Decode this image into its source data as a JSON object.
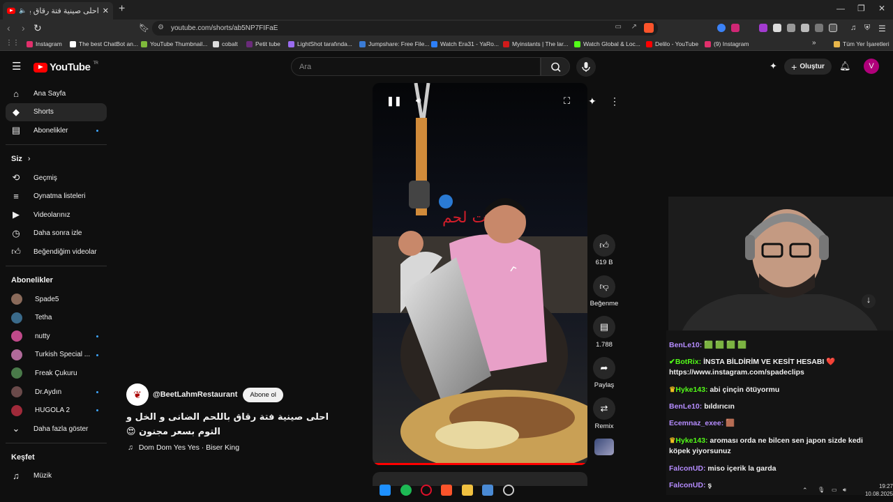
{
  "browser": {
    "tab_title": "احلی صینیة فتة رقاق باللحم الد",
    "url": "youtube.com/shorts/ab5NP7FIFaE",
    "bookmarks": [
      {
        "label": "Instagram",
        "color": "#e1306c"
      },
      {
        "label": "The best ChatBot an...",
        "color": "#ffffff"
      },
      {
        "label": "YouTube Thumbnail...",
        "color": "#7fb93b"
      },
      {
        "label": "cobalt",
        "color": "#dddddd"
      },
      {
        "label": "Petit tube",
        "color": "#6a2b7a"
      },
      {
        "label": "LightShot tarafında...",
        "color": "#9b6cf0"
      },
      {
        "label": "Jumpshare: Free File...",
        "color": "#3a7bd5"
      },
      {
        "label": "Watch Era31 - YaRo...",
        "color": "#2d7ff9"
      },
      {
        "label": "Myinstants | The lar...",
        "color": "#d11a1a"
      },
      {
        "label": "Watch Global & Loc...",
        "color": "#53fc18"
      },
      {
        "label": "Delilo - YouTube",
        "color": "#ff0000"
      },
      {
        "label": "(9) Instagram",
        "color": "#e1306c"
      }
    ],
    "all_bookmarks": "Tüm Yer İşaretleri"
  },
  "masthead": {
    "logo": "YouTube",
    "logo_country": "TR",
    "search_placeholder": "Ara",
    "create_label": "Oluştur",
    "avatar_letter": "V"
  },
  "sidebar": {
    "main": [
      {
        "label": "Ana Sayfa",
        "icon": "home-icon"
      },
      {
        "label": "Shorts",
        "icon": "shorts-icon"
      },
      {
        "label": "Abonelikler",
        "icon": "subscriptions-icon"
      }
    ],
    "you_heading": "Siz",
    "you": [
      {
        "label": "Geçmiş",
        "icon": "history-icon"
      },
      {
        "label": "Oynatma listeleri",
        "icon": "playlists-icon"
      },
      {
        "label": "Videolarınız",
        "icon": "your-videos-icon"
      },
      {
        "label": "Daha sonra izle",
        "icon": "watch-later-icon"
      },
      {
        "label": "Beğendiğim videolar",
        "icon": "liked-icon"
      }
    ],
    "subs_heading": "Abonelikler",
    "subs": [
      {
        "label": "Spade5",
        "color": "#8a6a5a"
      },
      {
        "label": "Tetha",
        "color": "#3a6a8a"
      },
      {
        "label": "nutty",
        "color": "#c04a8a"
      },
      {
        "label": "Turkish Special ...",
        "color": "#b06a9a"
      },
      {
        "label": "Freak Çukuru",
        "color": "#4a7a4a"
      },
      {
        "label": "Dr.Aydın",
        "color": "#6a4a4a"
      },
      {
        "label": "HUGOLA 2",
        "color": "#a02a3a"
      }
    ],
    "show_more": "Daha fazla göster",
    "explore_heading": "Keşfet",
    "explore": [
      {
        "label": "Müzik",
        "icon": "music-icon"
      }
    ]
  },
  "short": {
    "channel": "@BeetLahmRestaurant",
    "subscribe_label": "Abone ol",
    "title": "احلی صینیة فتة رقاق باللحم الضانی و الخل و التوم بسعر مجنون 😍",
    "music": "Dom Dom Yes Yes · Biser King",
    "progress": 0.99
  },
  "actions": {
    "likes": "619 B",
    "dislike": "Beğenme",
    "comments": "1.788",
    "share": "Paylaş",
    "remix": "Remix"
  },
  "chat": [
    {
      "user": "BenLe10:",
      "color": "#b58cff",
      "text": "🟩 🟩 🟩 🟩"
    },
    {
      "user": "BotRix:",
      "color": "#53fc18",
      "text": "İNSTA BİLDİRİM VE KESİT HESABI ❤️ https://www.instagram.com/spadeclips"
    },
    {
      "user": "Hyke143:",
      "color": "#53fc18",
      "text": "abi çinçin ötüyormu"
    },
    {
      "user": "BenLe10:",
      "color": "#b58cff",
      "text": "bıldırıcın"
    },
    {
      "user": "Ecemnaz_exee:",
      "color": "#b58cff",
      "text": "🟫"
    },
    {
      "user": "Hyke143:",
      "color": "#53fc18",
      "text": "aroması orda ne bilcen sen japon sizde kedi köpek yiyorsunuz"
    },
    {
      "user": "FalconUD:",
      "color": "#b58cff",
      "text": "miso içerik la garda"
    },
    {
      "user": "FalconUD:",
      "color": "#b58cff",
      "text": "ş"
    }
  ],
  "tray": {
    "time": "19:27",
    "date": "10.08.2025"
  }
}
